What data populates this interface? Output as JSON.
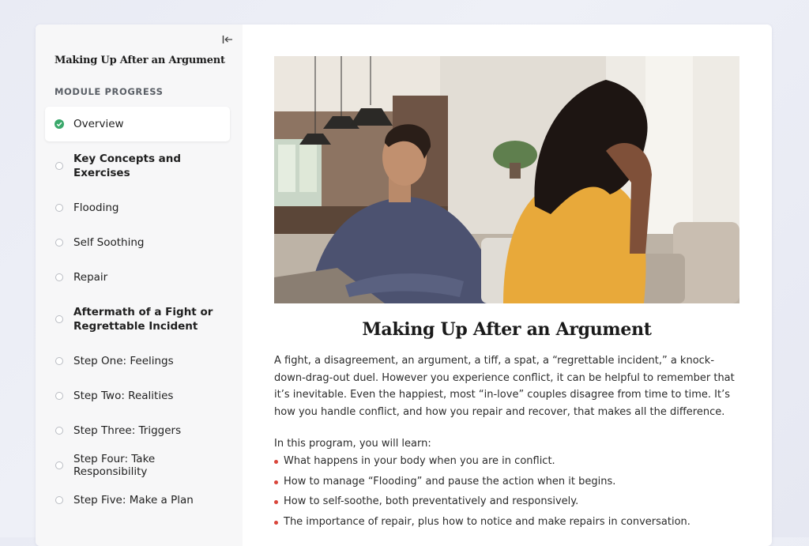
{
  "colors": {
    "accent_check": "#3aa86b",
    "bullet": "#d9453a",
    "sidebar_bg": "#f7f7f8"
  },
  "sidebar": {
    "collapse_icon": "collapse-sidebar-icon",
    "course_title": "Making Up After an Argument",
    "progress_label": "MODULE PROGRESS",
    "items": [
      {
        "label": "Overview",
        "status": "complete"
      },
      {
        "label": "Key Concepts and Exercises",
        "status": "incomplete"
      },
      {
        "label": "Flooding",
        "status": "incomplete"
      },
      {
        "label": "Self Soothing",
        "status": "incomplete"
      },
      {
        "label": "Repair",
        "status": "incomplete"
      },
      {
        "label": "Aftermath of a Fight or Regrettable Incident",
        "status": "incomplete"
      },
      {
        "label": "Step One: Feelings",
        "status": "incomplete"
      },
      {
        "label": "Step Two: Realities",
        "status": "incomplete"
      },
      {
        "label": "Step Three: Triggers",
        "status": "incomplete"
      },
      {
        "label": "Step Four: Take Responsibility",
        "status": "incomplete"
      },
      {
        "label": "Step Five: Make a Plan",
        "status": "incomplete"
      }
    ]
  },
  "main": {
    "title": "Making Up After an Argument",
    "intro": "A fight, a disagreement, an argument, a tiff, a spat, a “regrettable incident,” a knock-down-drag-out duel. However you experience conflict, it can be helpful to remember that it’s inevitable. Even the happiest, most “in-love” couples disagree from time to time. It’s how you handle conflict, and how you repair and recover, that makes all the difference.",
    "learn_intro": "In this program, you will learn:",
    "bullets": [
      "What happens in your body when you are in conflict.",
      "How to manage “Flooding” and pause the action when it begins.",
      "How to self-soothe, both preventatively and responsively.",
      "The importance of repair, plus how to notice and make repairs in conversation."
    ]
  }
}
